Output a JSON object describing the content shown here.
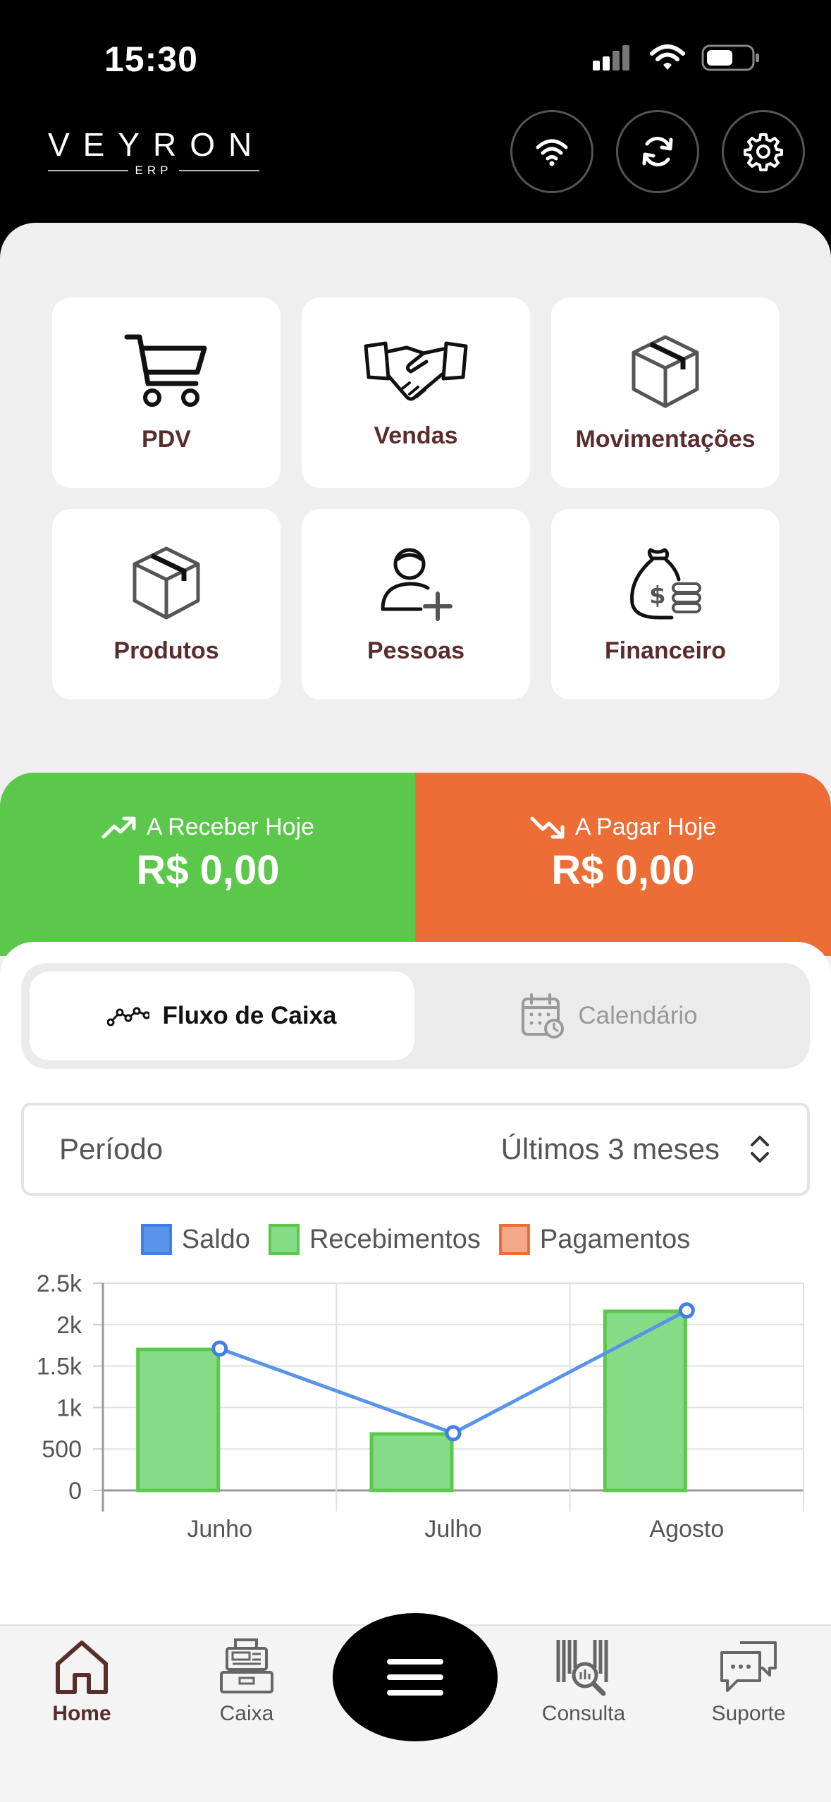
{
  "status_bar": {
    "time": "15:30"
  },
  "header": {
    "logo_main": "VEYRON",
    "logo_sub": "ERP"
  },
  "tiles": [
    {
      "label": "PDV",
      "icon": "cart-icon"
    },
    {
      "label": "Vendas",
      "icon": "handshake-icon"
    },
    {
      "label": "Movimentações",
      "icon": "box-icon"
    },
    {
      "label": "Produtos",
      "icon": "box-icon"
    },
    {
      "label": "Pessoas",
      "icon": "add-person-icon"
    },
    {
      "label": "Financeiro",
      "icon": "money-bag-icon"
    }
  ],
  "balances": {
    "receive": {
      "title": "A Receber Hoje",
      "value": "R$ 0,00",
      "color": "#5bc84c"
    },
    "pay": {
      "title": "A Pagar Hoje",
      "value": "R$ 0,00",
      "color": "#ec6d35"
    }
  },
  "tabs": {
    "cashflow": "Fluxo de Caixa",
    "calendar": "Calendário"
  },
  "period": {
    "label": "Período",
    "value": "Últimos 3 meses"
  },
  "chart_data": {
    "type": "bar",
    "categories": [
      "Junho",
      "Julho",
      "Agosto"
    ],
    "series": [
      {
        "name": "Saldo",
        "kind": "line",
        "color": "#5a93ea",
        "values": [
          1710,
          690,
          2170
        ]
      },
      {
        "name": "Recebimentos",
        "kind": "bar",
        "color": "#5bc84c",
        "values": [
          1700,
          680,
          2160
        ]
      },
      {
        "name": "Pagamentos",
        "kind": "bar",
        "color": "#ec6d35",
        "values": [
          0,
          0,
          0
        ]
      }
    ],
    "yticks": [
      "0",
      "500",
      "1k",
      "1.5k",
      "2k",
      "2.5k"
    ],
    "ylim": [
      0,
      2500
    ],
    "grid": true,
    "legend": "top"
  },
  "nav": {
    "home": "Home",
    "caixa": "Caixa",
    "consulta": "Consulta",
    "suporte": "Suporte"
  },
  "colors": {
    "accent": "#5a2d2d",
    "green": "#5bc84c",
    "orange": "#ec6d35",
    "blue": "#5a93ea"
  }
}
